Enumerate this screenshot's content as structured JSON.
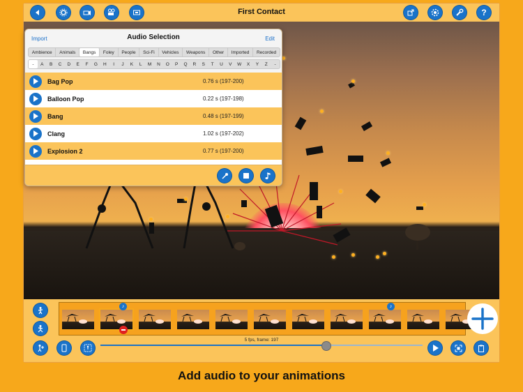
{
  "app": {
    "title": "First Contact",
    "caption": "Add audio to your animations"
  },
  "toolbar": {
    "left": [
      "back-icon",
      "gear-icon",
      "camera-icon",
      "movie-camera-icon",
      "frame-icon"
    ],
    "right": [
      "export-icon",
      "settings-icon",
      "wrench-icon",
      "help-icon"
    ]
  },
  "audio_panel": {
    "title": "Audio Selection",
    "import_label": "Import",
    "edit_label": "Edit",
    "categories": [
      "Ambience",
      "Animals",
      "Bangs",
      "Foley",
      "People",
      "Sci-Fi",
      "Vehicles",
      "Weapons",
      "Other",
      "Imported",
      "Recorded"
    ],
    "active_category": "Bangs",
    "letters": [
      "-",
      "A",
      "B",
      "C",
      "D",
      "E",
      "F",
      "G",
      "H",
      "I",
      "J",
      "K",
      "L",
      "M",
      "N",
      "O",
      "P",
      "Q",
      "R",
      "S",
      "T",
      "U",
      "V",
      "W",
      "X",
      "Y",
      "Z",
      "-"
    ],
    "active_letter": "-",
    "sounds": [
      {
        "name": "Bag Pop",
        "duration": "0.76 s  (197-200)"
      },
      {
        "name": "Balloon Pop",
        "duration": "0.22 s  (197-198)"
      },
      {
        "name": "Bang",
        "duration": "0.48 s  (197-199)"
      },
      {
        "name": "Clang",
        "duration": "1.02 s  (197-202)"
      },
      {
        "name": "Explosion 2",
        "duration": "0.77 s  (197-200)"
      }
    ]
  },
  "timeline": {
    "status": "5 fps, frame: 197",
    "progress": 0.7,
    "frame_count": 11,
    "selected_frame": 1
  },
  "colors": {
    "accent": "#1a73c9",
    "background": "#f7a81b",
    "panel": "#fbc45a"
  }
}
